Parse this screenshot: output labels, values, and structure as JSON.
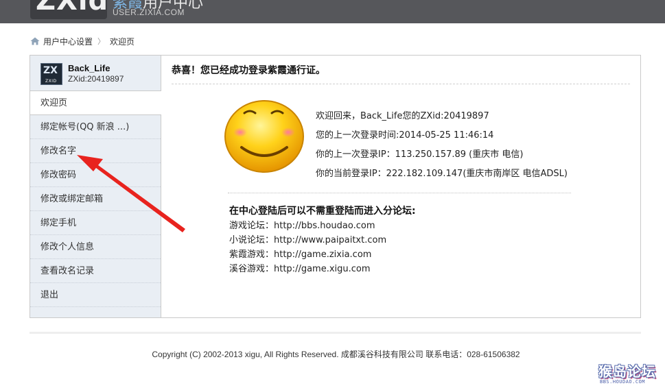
{
  "header": {
    "logo": "ZXid",
    "brand_a": "紫霞",
    "brand_b": "用户中心",
    "brand_url": "USER.ZIXIA.COM"
  },
  "breadcrumb": {
    "root": "用户中心设置",
    "separator": "〉",
    "current": "欢迎页"
  },
  "user": {
    "avatar_logo": "ZX",
    "avatar_tag": "ZXID",
    "name": "Back_Life",
    "id": "ZXid:20419897"
  },
  "menu": [
    {
      "label": "欢迎页",
      "active": true
    },
    {
      "label": "绑定帐号(QQ 新浪 ...)"
    },
    {
      "label": "修改名字"
    },
    {
      "label": "修改密码"
    },
    {
      "label": "修改或绑定邮箱"
    },
    {
      "label": "绑定手机"
    },
    {
      "label": "修改个人信息"
    },
    {
      "label": "查看改名记录"
    },
    {
      "label": "退出"
    }
  ],
  "welcome": {
    "title": "恭喜！您已经成功登录紫霞通行证。",
    "lines": [
      "欢迎回来，Back_Life您的ZXid:20419897",
      "您的上一次登录时间:2014-05-25 11:46:14",
      "你的上一次登录IP：113.250.157.89 (重庆市 电信)",
      "你的当前登录IP：222.182.109.147(重庆市南岸区 电信ADSL)"
    ]
  },
  "forums": {
    "heading": "在中心登陆后可以不需重登陆而进入分论坛:",
    "items": [
      "游戏论坛：http://bbs.houdao.com",
      "小说论坛：http://www.paipaitxt.com",
      "紫霞游戏：http://game.zixia.com",
      "溪谷游戏：http://game.xigu.com"
    ]
  },
  "footer": {
    "copyright": "Copyright (C) 2002-2013 xigu, All Rights Reserved. 成都溪谷科技有限公司 联系电话：028-61506382"
  },
  "watermark": {
    "main": "猴岛论坛",
    "url": "BBS.HOUDAO.COM"
  },
  "colors": {
    "header_bg": "#56575b",
    "sidebar_bg": "#e9eef4",
    "annotation_arrow": "#e8231e",
    "smiley_face": "#f5b800"
  },
  "icons": [
    "home-icon",
    "smiley-icon",
    "arrow-annotation"
  ]
}
